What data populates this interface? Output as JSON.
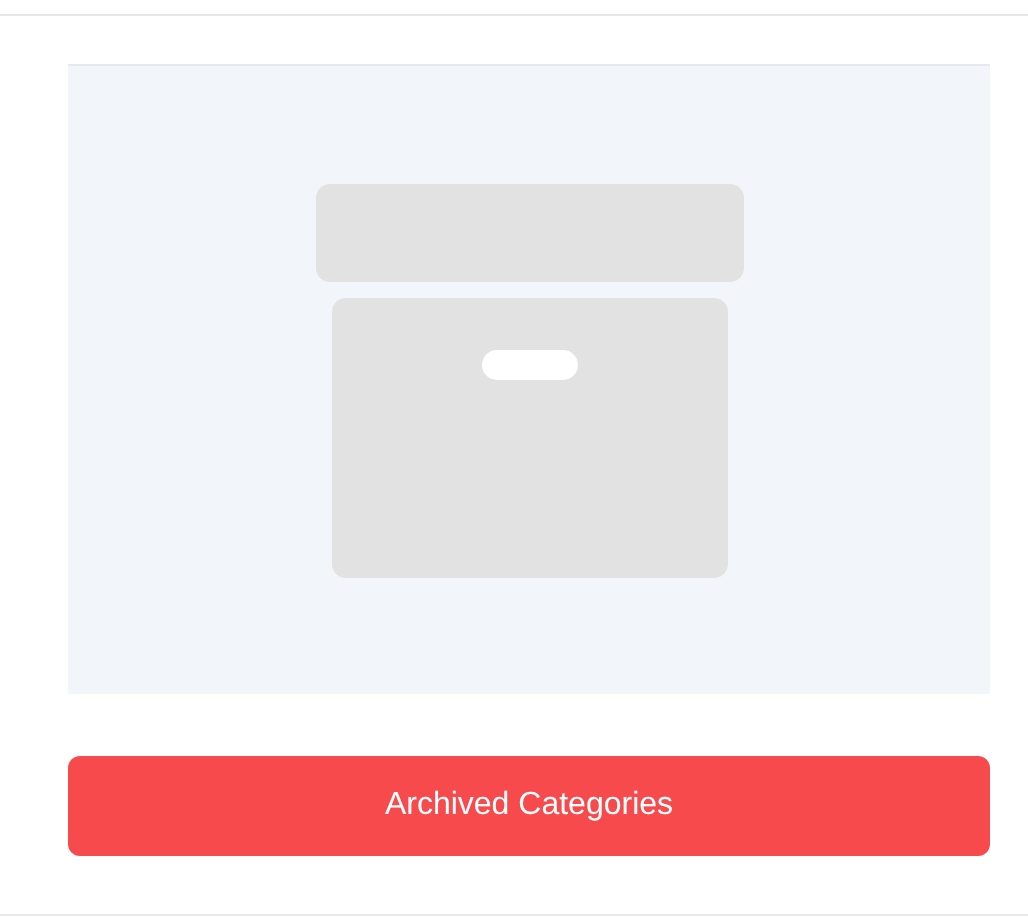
{
  "button": {
    "label": "Archived Categories"
  }
}
